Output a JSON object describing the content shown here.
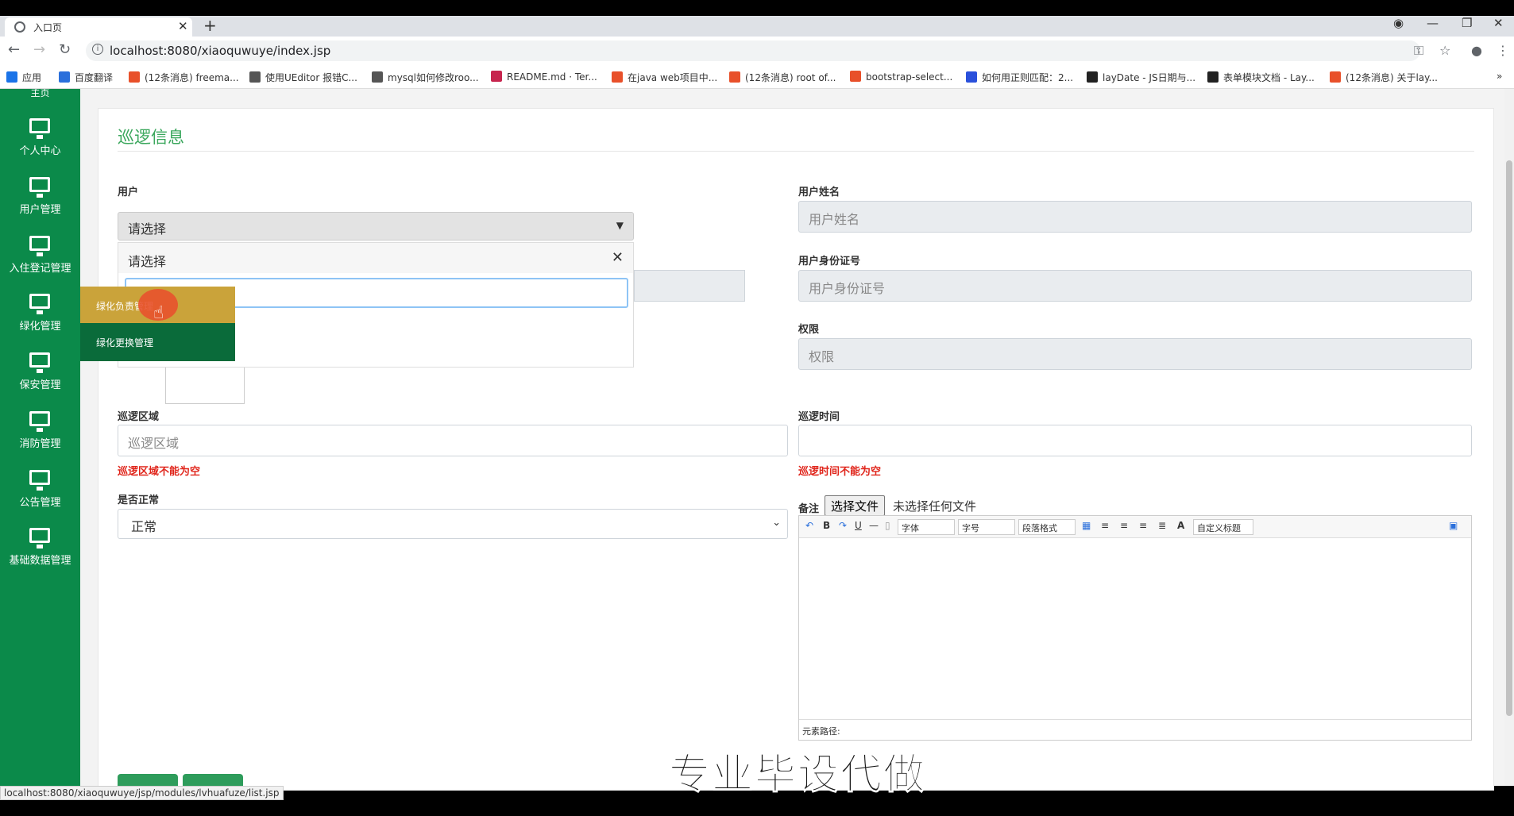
{
  "browser": {
    "tab_title": "入口页",
    "url": "localhost:8080/xiaoquwuye/index.jsp",
    "status_url": "localhost:8080/xiaoquwuye/jsp/modules/lvhuafuze/list.jsp",
    "bookmarks": [
      {
        "label": "应用",
        "color": "#1a73e8"
      },
      {
        "label": "百度翻译",
        "color": "#2a6fdb"
      },
      {
        "label": "(12条消息) freema...",
        "color": "#e8502a"
      },
      {
        "label": "使用UEditor 报错C...",
        "color": "#555555"
      },
      {
        "label": "mysql如何修改roo...",
        "color": "#555555"
      },
      {
        "label": "README.md · Ter...",
        "color": "#c7254e"
      },
      {
        "label": "在java web项目中...",
        "color": "#e8502a"
      },
      {
        "label": "(12条消息) root of...",
        "color": "#e8502a"
      },
      {
        "label": "bootstrap-select...",
        "color": "#e8502a"
      },
      {
        "label": "如何用正则匹配：2...",
        "color": "#2a50db"
      },
      {
        "label": "layDate - JS日期与...",
        "color": "#222222"
      },
      {
        "label": "表单模块文档 - Lay...",
        "color": "#222222"
      },
      {
        "label": "(12条消息) 关于lay...",
        "color": "#e8502a"
      }
    ]
  },
  "sidebar": {
    "top_partial": "主页",
    "items": [
      {
        "label": "个人中心"
      },
      {
        "label": "用户管理"
      },
      {
        "label": "入住登记管理"
      },
      {
        "label": "绿化管理"
      },
      {
        "label": "保安管理"
      },
      {
        "label": "消防管理"
      },
      {
        "label": "公告管理"
      },
      {
        "label": "基础数据管理"
      }
    ],
    "submenu": [
      {
        "label": "绿化负责管理"
      },
      {
        "label": "绿化更换管理"
      }
    ]
  },
  "form": {
    "title": "巡逻信息",
    "user_label": "用户",
    "user_select_value": "请选择",
    "dropdown_header": "请选择",
    "user_name_label": "用户姓名",
    "user_name_placeholder": "用户姓名",
    "id_card_label": "用户身份证号",
    "id_card_placeholder": "用户身份证号",
    "permission_label": "权限",
    "permission_placeholder": "权限",
    "area_label": "巡逻区域",
    "area_placeholder": "巡逻区域",
    "area_error": "巡逻区域不能为空",
    "time_label": "巡逻时间",
    "time_error": "巡逻时间不能为空",
    "normal_label": "是否正常",
    "normal_value": "正常",
    "remark_label": "备注",
    "file_button": "选择文件",
    "file_status": "未选择任何文件"
  },
  "editor": {
    "font_select": "字体",
    "size_select": "字号",
    "paragraph_select": "段落格式",
    "custom_title_select": "自定义标题",
    "path_label": "元素路径:"
  },
  "overlay": {
    "watermark": "专业毕设代做"
  }
}
